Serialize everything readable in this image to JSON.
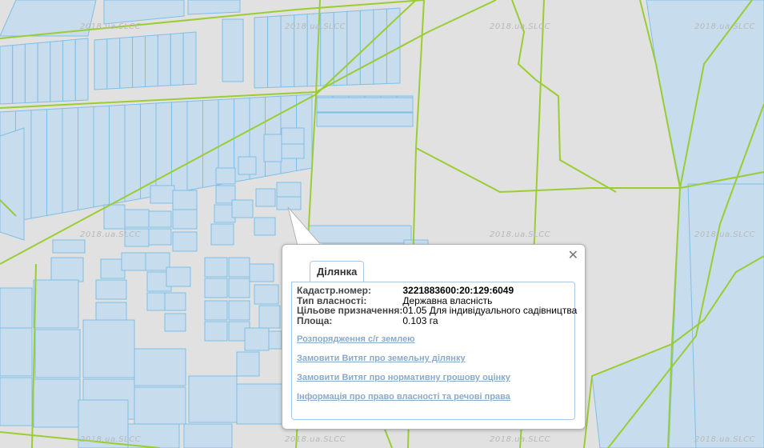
{
  "watermark": "2018.ua.SLCC",
  "popup": {
    "tab_label": "Ділянка",
    "close_symbol": "✕",
    "fields": [
      {
        "label": "Кадастр.номер:",
        "value": "3221883600:20:129:6049"
      },
      {
        "label": "Тип власності:",
        "value": "Державна власність"
      },
      {
        "label": "Цільове призначення:",
        "value": "01.05 Для індивідуального садівництва"
      },
      {
        "label": "Площа:",
        "value": "0.103 га"
      }
    ],
    "links": [
      "Розпорядження с/г землею",
      "Замовити Витяг про земельну ділянку",
      "Замовити Витяг про нормативну грошову оцінку",
      "Інформація про право власності та речові права"
    ]
  },
  "colors": {
    "background": "#e1e1e1",
    "parcel_fill": "#c7dcec",
    "parcel_stroke": "#7fbfe6",
    "boundary": "#9acd32",
    "link": "#8aaacc"
  }
}
